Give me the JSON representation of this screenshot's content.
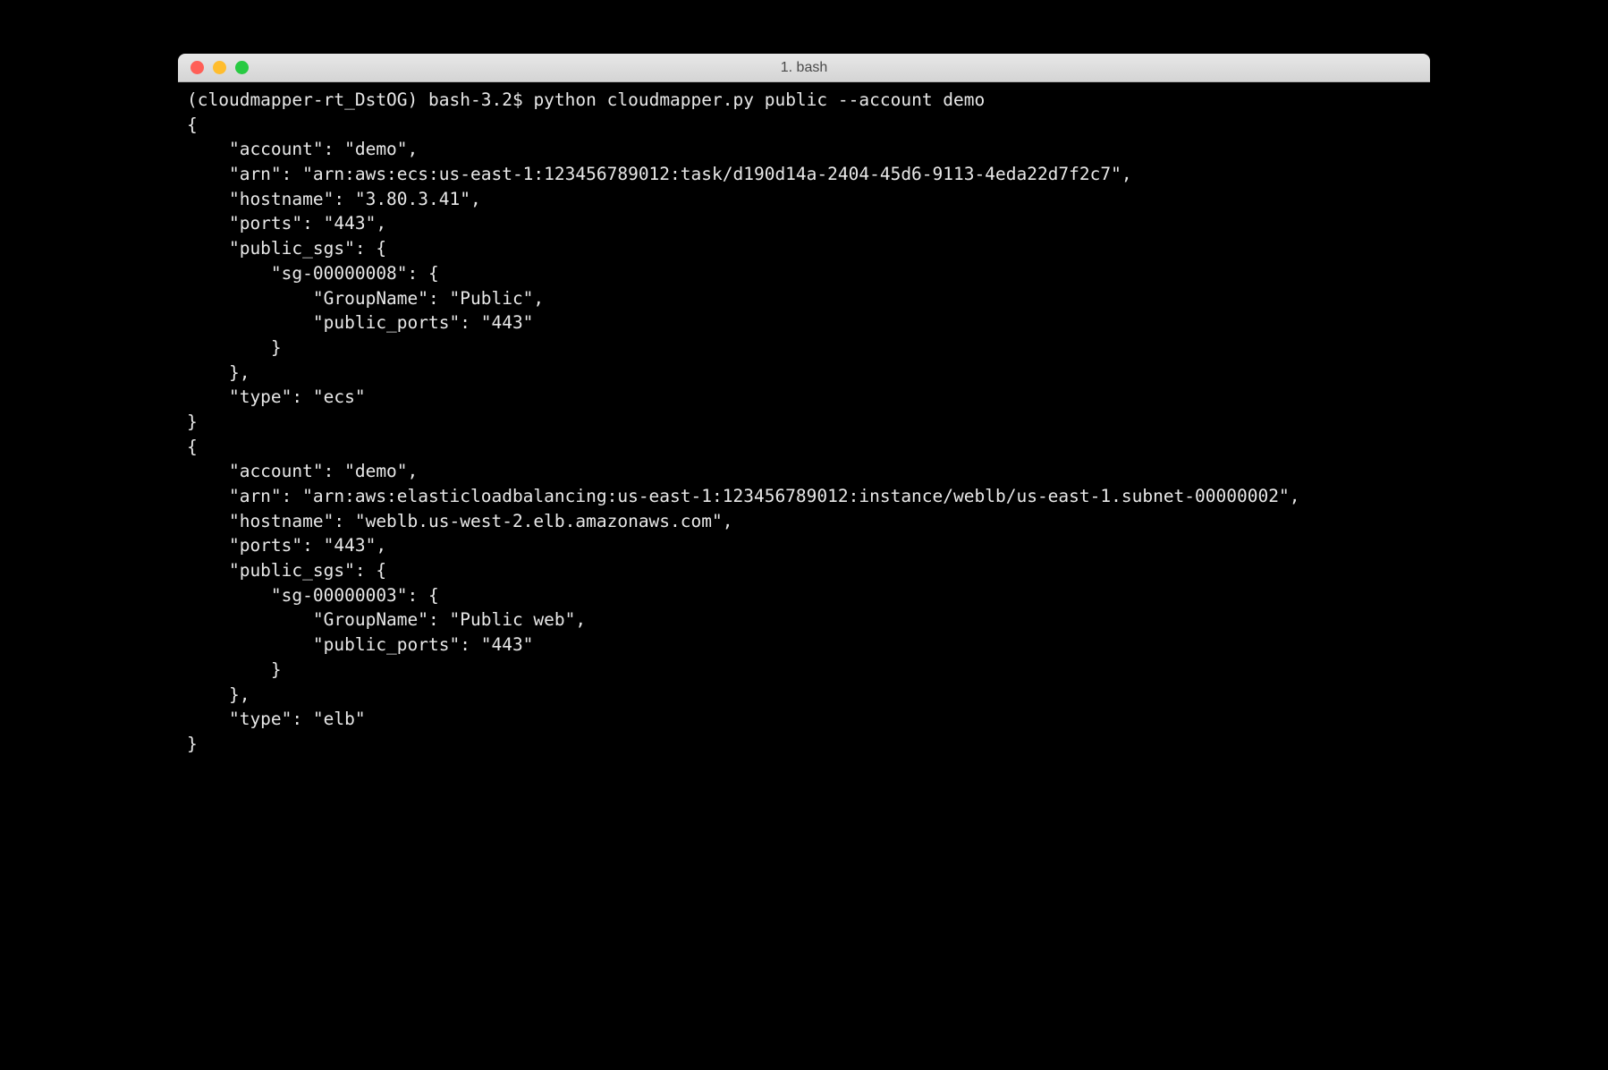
{
  "window": {
    "title": "1. bash"
  },
  "prompt": {
    "env": "(cloudmapper-rt_DstOG) ",
    "shell": "bash-3.2$ ",
    "command": "python cloudmapper.py public --account demo"
  },
  "output": {
    "lines": [
      "{",
      "    \"account\": \"demo\",",
      "    \"arn\": \"arn:aws:ecs:us-east-1:123456789012:task/d190d14a-2404-45d6-9113-4eda22d7f2c7\",",
      "    \"hostname\": \"3.80.3.41\",",
      "    \"ports\": \"443\",",
      "    \"public_sgs\": {",
      "        \"sg-00000008\": {",
      "            \"GroupName\": \"Public\",",
      "            \"public_ports\": \"443\"",
      "        }",
      "    },",
      "    \"type\": \"ecs\"",
      "}",
      "{",
      "    \"account\": \"demo\",",
      "    \"arn\": \"arn:aws:elasticloadbalancing:us-east-1:123456789012:instance/weblb/us-east-1.subnet-00000002\",",
      "    \"hostname\": \"weblb.us-west-2.elb.amazonaws.com\",",
      "    \"ports\": \"443\",",
      "    \"public_sgs\": {",
      "        \"sg-00000003\": {",
      "            \"GroupName\": \"Public web\",",
      "            \"public_ports\": \"443\"",
      "        }",
      "    },",
      "    \"type\": \"elb\"",
      "}"
    ]
  }
}
